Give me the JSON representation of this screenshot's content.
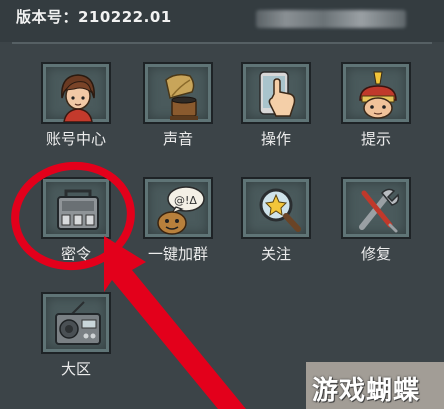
{
  "header": {
    "version_text": "版本号：210222.01"
  },
  "menu": {
    "items": [
      {
        "label": "账号中心",
        "icon": "avatar-icon"
      },
      {
        "label": "声音",
        "icon": "gramophone-icon"
      },
      {
        "label": "操作",
        "icon": "touch-hand-icon"
      },
      {
        "label": "提示",
        "icon": "hint-character-icon"
      },
      {
        "label": "密令",
        "icon": "code-device-icon"
      },
      {
        "label": "一键加群",
        "icon": "chat-bubble-icon"
      },
      {
        "label": "关注",
        "icon": "magnifier-icon"
      },
      {
        "label": "修复",
        "icon": "wrench-screwdriver-icon"
      },
      {
        "label": "大区",
        "icon": "radio-icon"
      }
    ]
  },
  "annotation": {
    "color": "#e3001b",
    "shapes": [
      "circle",
      "arrow"
    ]
  },
  "watermark": {
    "text": "游戏蝴蝶"
  }
}
